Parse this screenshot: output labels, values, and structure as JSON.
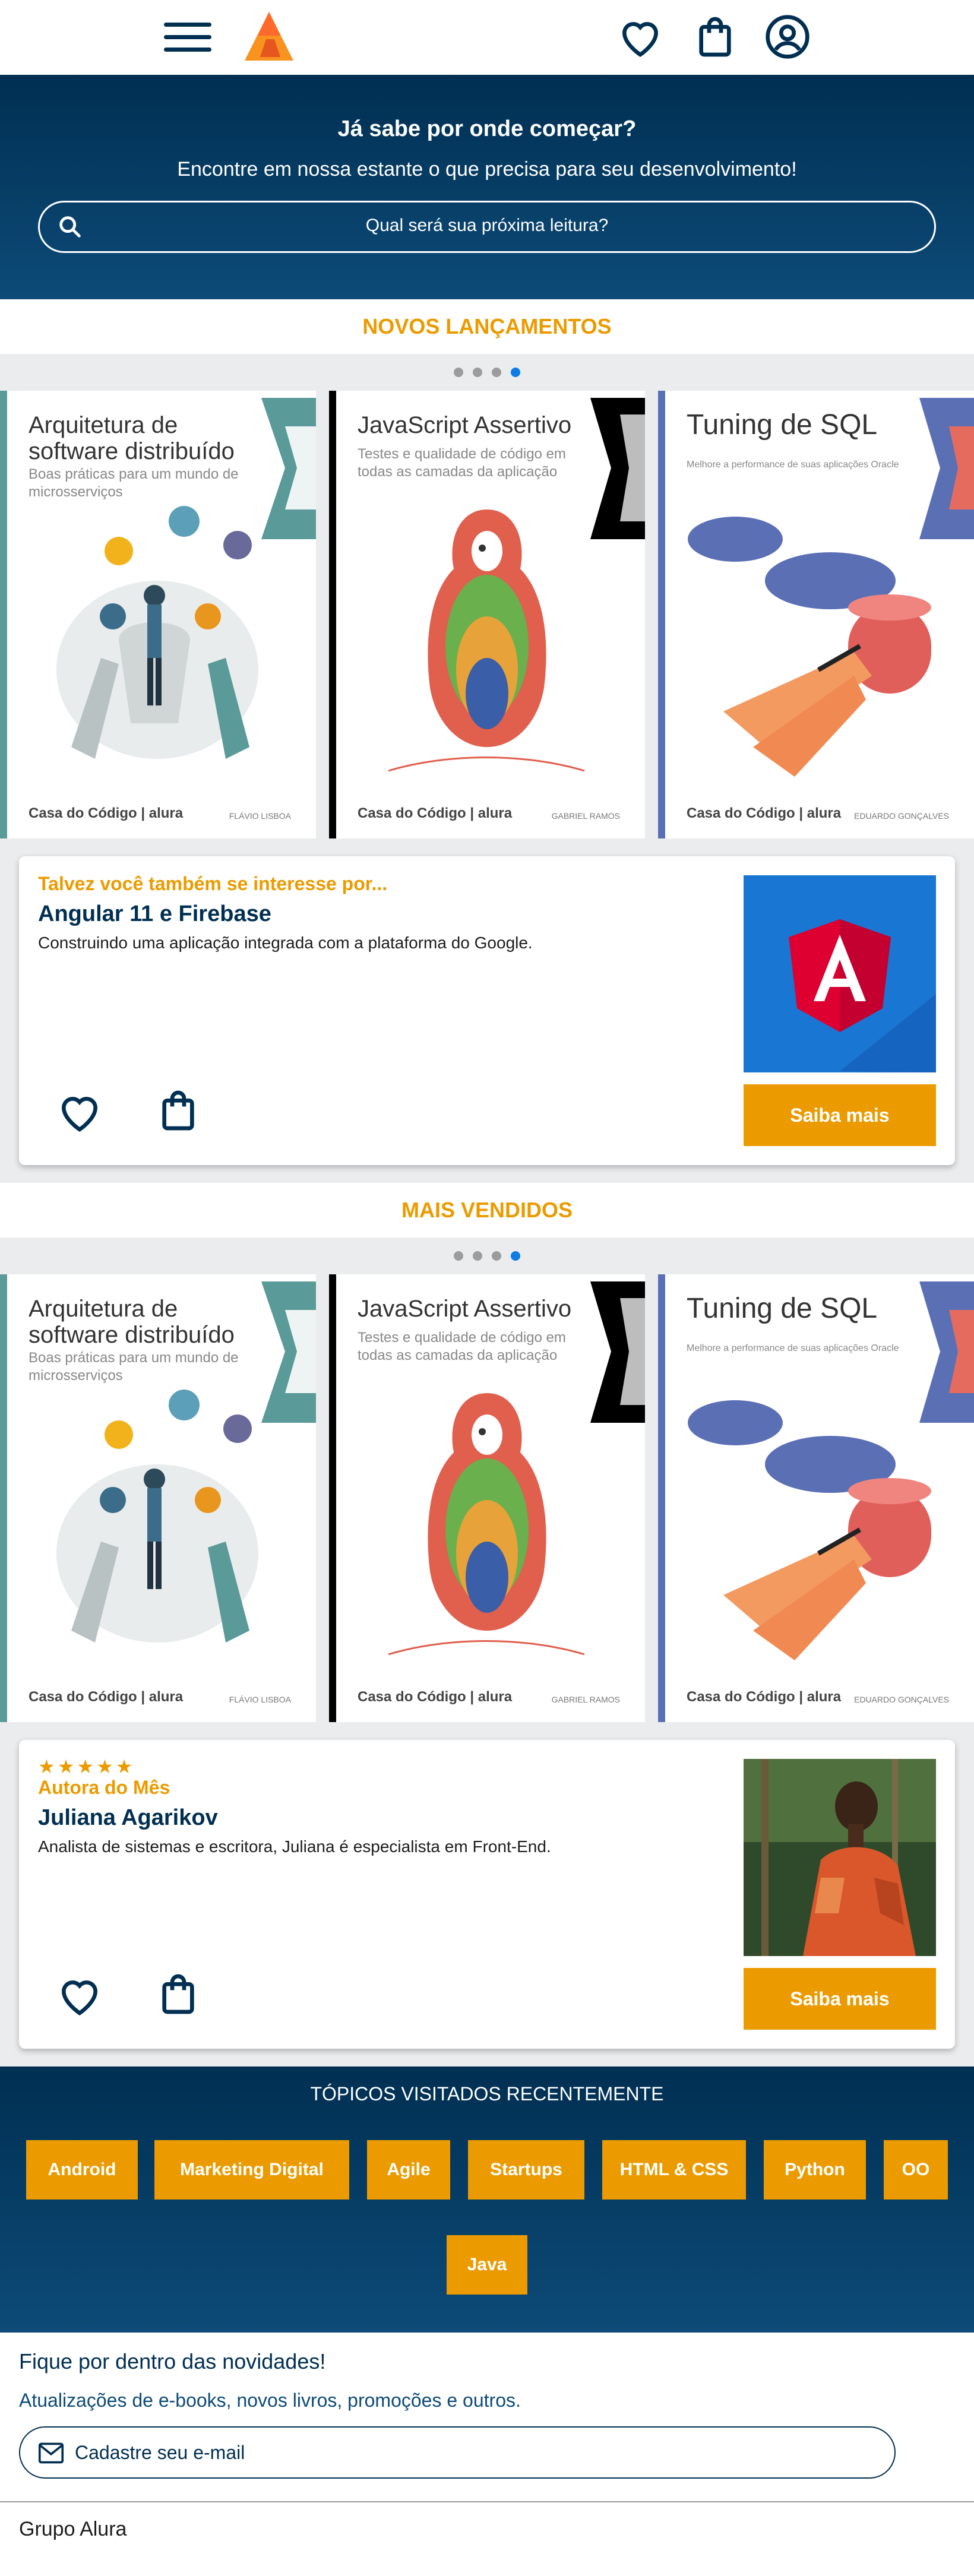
{
  "header": {
    "menu_icon": "hamburger-icon",
    "logo_icon": "alura-triangle-logo",
    "favorites_icon": "heart-icon",
    "bag_icon": "shopping-bag-icon",
    "account_icon": "user-circle-icon"
  },
  "hero": {
    "title": "Já sabe por onde começar?",
    "subtitle": "Encontre em nossa estante o que precisa para seu desenvolvimento!",
    "search_placeholder": "Qual será sua próxima leitura?"
  },
  "colors": {
    "navy": "#002f52",
    "orange": "#eb9b00",
    "grey_bg": "#ebecee",
    "dot_active": "#0d7ce6"
  },
  "new_releases": {
    "title": "NOVOS LANÇAMENTOS",
    "books": [
      {
        "title_line1": "Arquitetura de",
        "title_line2": "software distribuído",
        "subtitle": "Boas práticas para um mundo de microsserviços",
        "publisher": "Casa do Código | alura",
        "author": "FLÁVIO LISBOA"
      },
      {
        "title_line1": "JavaScript Assertivo",
        "title_line2": "",
        "subtitle": "Testes e qualidade de código em todas as camadas da aplicação",
        "publisher": "Casa do Código | alura",
        "author": "GABRIEL RAMOS"
      },
      {
        "title_line1": "Tuning de SQL",
        "title_line2": "",
        "subtitle": "Melhore a performance de suas aplicações Oracle",
        "publisher": "Casa do Código | alura",
        "author": "EDUARDO GONÇALVES"
      }
    ],
    "card": {
      "kicker": "Talvez você também se interesse por...",
      "title": "Angular 11 e Firebase",
      "description": "Construindo uma aplicação integrada com a plataforma do Google.",
      "button": "Saiba mais"
    }
  },
  "best_sellers": {
    "title": "MAIS VENDIDOS",
    "books": [
      {
        "title_line1": "Arquitetura de",
        "title_line2": "software distribuído",
        "subtitle": "Boas práticas para um mundo de microsserviços",
        "publisher": "Casa do Código | alura",
        "author": "FLÁVIO LISBOA"
      },
      {
        "title_line1": "JavaScript Assertivo",
        "title_line2": "",
        "subtitle": "Testes e qualidade de código em todas as camadas da aplicação",
        "publisher": "Casa do Código | alura",
        "author": "GABRIEL RAMOS"
      },
      {
        "title_line1": "Tuning de SQL",
        "title_line2": "",
        "subtitle": "Melhore a performance de suas aplicações Oracle",
        "publisher": "Casa do Código | alura",
        "author": "EDUARDO GONÇALVES"
      }
    ],
    "card": {
      "stars": "★★★★★",
      "kicker": "Autora do Mês",
      "title": "Juliana Agarikov",
      "description": "Analista de sistemas e escritora, Juliana é especialista em Front-End.",
      "button": "Saiba mais"
    }
  },
  "topics": {
    "title": "TÓPICOS VISITADOS RECENTEMENTE",
    "tags": [
      "Android",
      "Marketing Digital",
      "Agile",
      "Startups",
      "HTML & CSS",
      "Python",
      "OO",
      "Java"
    ]
  },
  "newsletter": {
    "title": "Fique por dentro das novidades!",
    "subtitle": "Atualizações de e-books, novos livros, promoções e outros.",
    "input_label": "Cadastre seu e-mail"
  },
  "footer": {
    "text": "Grupo Alura"
  }
}
